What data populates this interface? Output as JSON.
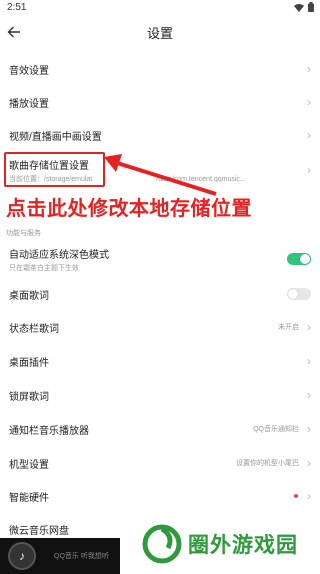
{
  "status_bar": {
    "time": "2:51"
  },
  "header": {
    "title": "设置"
  },
  "rows": {
    "sound_effects": {
      "title": "音效设置"
    },
    "playback": {
      "title": "播放设置"
    },
    "video_pip": {
      "title": "视频/直播画中画设置"
    },
    "storage_location": {
      "title": "歌曲存储位置设置",
      "subtitle_prefix": "当前位置：/storage/emulat",
      "subtitle_suffix": "/data/com.tencent.qqmusic..."
    },
    "adaptive_dark": {
      "title": "自动适应系统深色模式",
      "subtitle": "只在霜茶白主题下生效",
      "toggle_on": true
    },
    "desktop_lyrics": {
      "title": "桌面歌词",
      "toggle_on": false
    },
    "status_bar_lyrics": {
      "title": "状态栏歌词",
      "value": "未开启"
    },
    "desktop_widget": {
      "title": "桌面插件"
    },
    "lock_screen_lyrics": {
      "title": "锁屏歌词"
    },
    "notification_player": {
      "title": "通知栏音乐播放器",
      "value": "QQ音乐通知栏"
    },
    "device_model": {
      "title": "机型设置",
      "value": "设置你的机型小尾巴"
    },
    "smart_device": {
      "title": "智能硬件"
    },
    "weiyun_drive": {
      "title": "微云音乐网盘"
    }
  },
  "section": {
    "function_label": "功能与服务"
  },
  "annotation": {
    "text": "点击此处修改本地存储位置"
  },
  "player": {
    "text": "QQ音乐 听我想听"
  },
  "watermark": {
    "text": "圈外游戏园"
  },
  "colors": {
    "accent_green": "#31c27c",
    "annotation_red": "#e42222",
    "badge_red": "#f5434b"
  }
}
